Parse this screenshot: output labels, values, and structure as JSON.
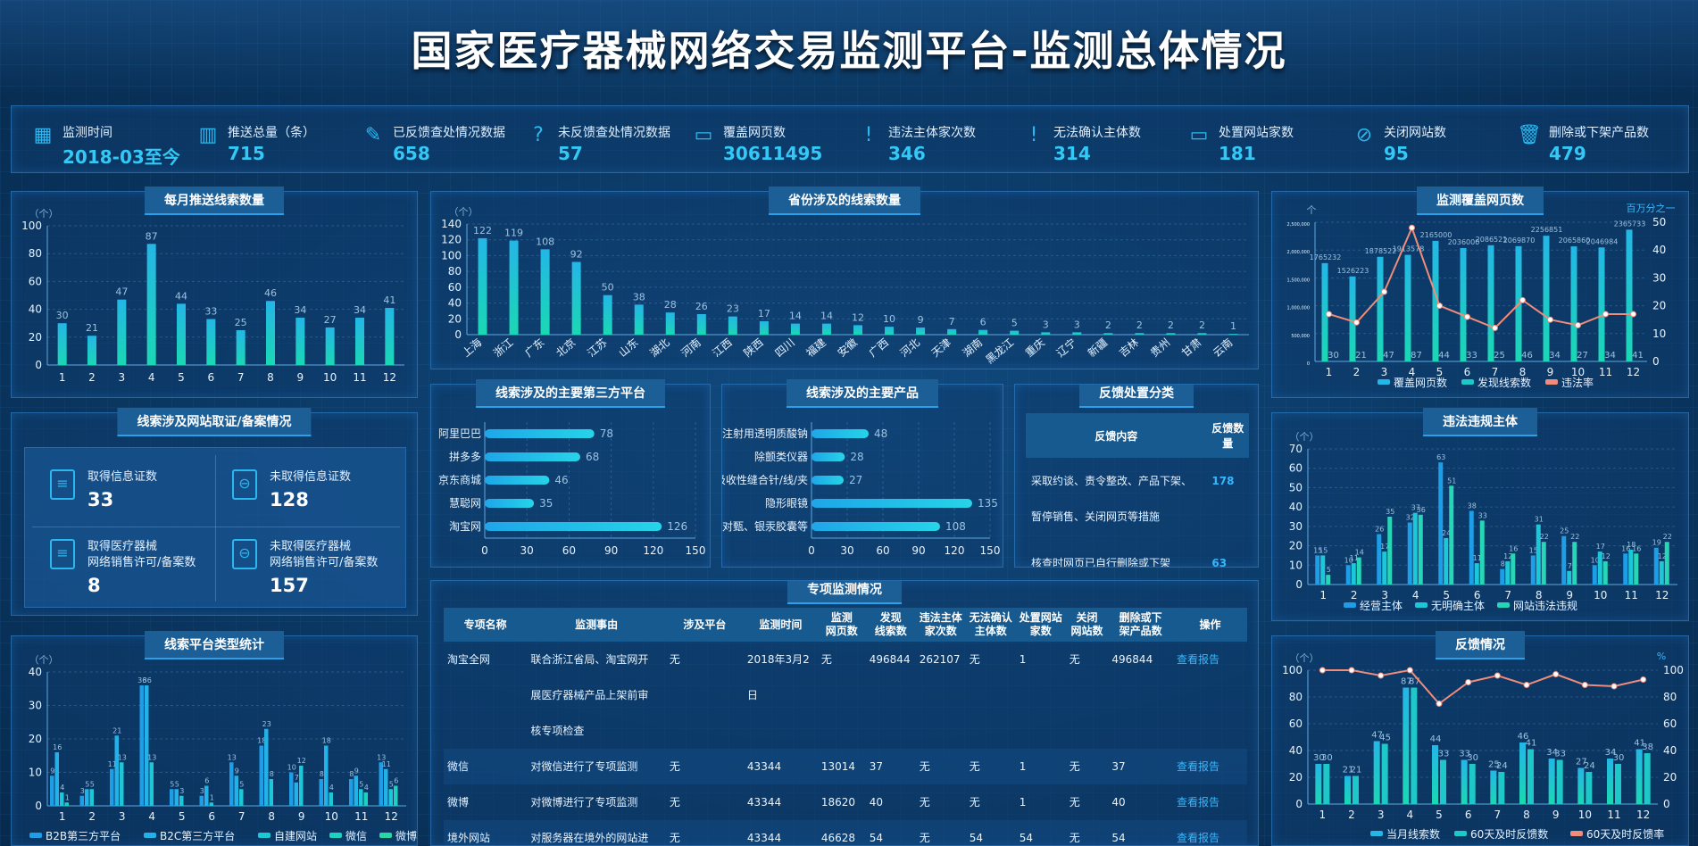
{
  "title": "国家医疗器械网络交易监测平台-监测总体情况",
  "stats": [
    {
      "icon": "calendar-icon",
      "label": "监测时间",
      "value": "2018-03至今"
    },
    {
      "icon": "bar-chart-icon",
      "label": "推送总量（条）",
      "value": "715"
    },
    {
      "icon": "document-edit-icon",
      "label": "已反馈查处情况数据",
      "value": "658"
    },
    {
      "icon": "document-question-icon",
      "label": "未反馈查处情况数据",
      "value": "57"
    },
    {
      "icon": "monitor-icon",
      "label": "覆盖网页数",
      "value": "30611495"
    },
    {
      "icon": "alert-icon",
      "label": "违法主体家次数",
      "value": "346"
    },
    {
      "icon": "alert-icon",
      "label": "无法确认主体数",
      "value": "314"
    },
    {
      "icon": "monitor-icon",
      "label": "处置网站家数",
      "value": "181"
    },
    {
      "icon": "ban-icon",
      "label": "关闭网站数",
      "value": "95"
    },
    {
      "icon": "trash-icon",
      "label": "删除或下架产品数",
      "value": "479"
    }
  ],
  "panels": {
    "monthly": "每月推送线索数量",
    "province": "省份涉及的线索数量",
    "coverage": "监测覆盖网页数",
    "license": "线索涉及网站取证/备案情况",
    "platforms": "线索涉及的主要第三方平台",
    "products": "线索涉及的主要产品",
    "feedback_cat": "反馈处置分类",
    "violation": "违法违规主体",
    "platform_type": "线索平台类型统计",
    "special": "专项监测情况",
    "feedback": "反馈情况"
  },
  "license": [
    {
      "icon": "document-icon",
      "label": "取得信息证数",
      "value": "33"
    },
    {
      "icon": "document-minus-icon",
      "label": "未取得信息证数",
      "value": "128"
    },
    {
      "icon": "document-icon",
      "label": "取得医疗器械\n网络销售许可/备案数",
      "value": "8"
    },
    {
      "icon": "document-minus-icon",
      "label": "未取得医疗器械\n网络销售许可/备案数",
      "value": "157"
    }
  ],
  "feedback_cat": {
    "headers": [
      "反馈内容",
      "反馈数量"
    ],
    "rows": [
      {
        "content": "采取约谈、责令整改、产品下架、暂停销售、关闭网页等措施",
        "count": "178"
      },
      {
        "content": "核查时网页已自行删除或下架",
        "count": "63"
      }
    ]
  },
  "special": {
    "headers": [
      "专项名称",
      "监测事由",
      "涉及平台",
      "监测时间",
      "监测\n网页数",
      "发现\n线索数",
      "违法主体\n家次数",
      "无法确认\n主体数",
      "处置网站\n家数",
      "关闭\n网站数",
      "删除或下\n架产品数",
      "操作"
    ],
    "rows": [
      [
        "淘宝全网",
        "联合浙江省局、淘宝网开\n展医疗器械产品上架前审\n核专项检查",
        "无",
        "2018年3月2日",
        "无",
        "496844",
        "262107",
        "无",
        "1",
        "无",
        "496844",
        "查看报告"
      ],
      [
        "微信",
        "对微信进行了专项监测",
        "无",
        "43344",
        "13014",
        "37",
        "无",
        "无",
        "1",
        "无",
        "37",
        "查看报告"
      ],
      [
        "微博",
        "对微博进行了专项监测",
        "无",
        "43344",
        "18620",
        "40",
        "无",
        "无",
        "1",
        "无",
        "40",
        "查看报告"
      ],
      [
        "境外网站",
        "对服务器在境外的网站进",
        "无",
        "43344",
        "46628",
        "54",
        "无",
        "54",
        "54",
        "无",
        "54",
        "查看报告"
      ]
    ]
  },
  "chart_data": [
    {
      "id": "monthly",
      "type": "bar",
      "ylabel": "（个）",
      "ylim": [
        0,
        100
      ],
      "categories": [
        "1",
        "2",
        "3",
        "4",
        "5",
        "6",
        "7",
        "8",
        "9",
        "10",
        "11",
        "12"
      ],
      "values": [
        30,
        21,
        47,
        87,
        44,
        33,
        25,
        46,
        34,
        27,
        34,
        41
      ]
    },
    {
      "id": "province",
      "type": "bar",
      "ylabel": "（个）",
      "ylim": [
        0,
        140
      ],
      "categories": [
        "上海",
        "浙江",
        "广东",
        "北京",
        "江苏",
        "山东",
        "湖北",
        "河南",
        "江西",
        "陕西",
        "四川",
        "福建",
        "安徽",
        "广西",
        "河北",
        "天津",
        "湖南",
        "黑龙江",
        "重庆",
        "辽宁",
        "新疆",
        "吉林",
        "贵州",
        "甘肃",
        "云南"
      ],
      "values": [
        122,
        119,
        108,
        92,
        50,
        38,
        28,
        26,
        23,
        17,
        14,
        14,
        12,
        10,
        9,
        7,
        6,
        5,
        3,
        3,
        2,
        2,
        2,
        2,
        1
      ]
    },
    {
      "id": "coverage",
      "type": "bar+line",
      "ylabel": "个",
      "ylabel2": "百万分之一",
      "categories": [
        "1",
        "2",
        "3",
        "4",
        "5",
        "6",
        "7",
        "8",
        "9",
        "10",
        "11",
        "12"
      ],
      "series": [
        {
          "name": "覆盖网页数",
          "values": [
            1765232,
            1526223,
            1878522,
            1913578,
            2165000,
            2036000,
            2086521,
            2069870,
            2256851,
            2065860,
            2046984,
            2365733
          ]
        },
        {
          "name": "发现线索数",
          "values": [
            30,
            21,
            47,
            87,
            44,
            33,
            25,
            46,
            34,
            27,
            34,
            41
          ]
        },
        {
          "name": "违法率",
          "values": [
            17,
            14,
            25,
            48,
            20,
            16,
            12,
            22,
            15,
            13,
            17,
            17
          ]
        }
      ],
      "ylim": [
        0,
        2500000
      ],
      "y2lim": [
        0,
        50
      ]
    },
    {
      "id": "platforms",
      "type": "hbar",
      "categories": [
        "阿里巴巴",
        "拼多多",
        "京东商城",
        "慧聪网",
        "淘宝网"
      ],
      "values": [
        78,
        68,
        46,
        35,
        126
      ],
      "xlim": [
        0,
        150
      ]
    },
    {
      "id": "products",
      "type": "hbar",
      "categories": [
        "注射用透明质酸钠",
        "除颤类仪器",
        "可吸收性缝合针/线/夹",
        "隐形眼镜",
        "对甄、银汞胶囊等"
      ],
      "values": [
        48,
        28,
        27,
        135,
        108
      ],
      "xlim": [
        0,
        150
      ]
    },
    {
      "id": "violation",
      "type": "grouped-bar",
      "ylabel": "（个）",
      "ylim": [
        0,
        70
      ],
      "categories": [
        "1",
        "2",
        "3",
        "4",
        "5",
        "6",
        "7",
        "8",
        "9",
        "10",
        "11",
        "12"
      ],
      "series": [
        {
          "name": "经营主体",
          "values": [
            15,
            10,
            26,
            32,
            63,
            38,
            8,
            15,
            25,
            10,
            16,
            19
          ]
        },
        {
          "name": "无明确主体",
          "values": [
            15,
            11,
            17,
            37,
            24,
            11,
            12,
            31,
            7,
            17,
            18,
            12
          ]
        },
        {
          "name": "网站违法违规",
          "values": [
            5,
            14,
            35,
            36,
            51,
            33,
            16,
            22,
            22,
            12,
            16,
            22
          ]
        }
      ]
    },
    {
      "id": "platform_type",
      "type": "grouped-bar",
      "ylabel": "（个）",
      "ylim": [
        0,
        40
      ],
      "categories": [
        "1",
        "2",
        "3",
        "4",
        "5",
        "6",
        "7",
        "8",
        "9",
        "10",
        "11",
        "12"
      ],
      "series": [
        {
          "name": "B2B第三方平台",
          "values": [
            9,
            3,
            11,
            36,
            5,
            3,
            13,
            18,
            10,
            8,
            8,
            13
          ]
        },
        {
          "name": "B2C第三方平台",
          "values": [
            16,
            5,
            21,
            36,
            5,
            6,
            9,
            23,
            7,
            18,
            9,
            11
          ]
        },
        {
          "name": "自建网站",
          "values": [
            4,
            5,
            13,
            13,
            3,
            1,
            5,
            8,
            12,
            4,
            5,
            5
          ]
        },
        {
          "name": "微信",
          "values": [
            1,
            0,
            0,
            0,
            0,
            0,
            0,
            0,
            0,
            0,
            4,
            6
          ]
        },
        {
          "name": "微博",
          "values": [
            0,
            0,
            0,
            0,
            0,
            0,
            0,
            0,
            0,
            0,
            0,
            0
          ]
        }
      ]
    },
    {
      "id": "feedback",
      "type": "bar+line",
      "ylabel": "（个）",
      "ylabel2": "%",
      "ylim": [
        0,
        100
      ],
      "y2lim": [
        0,
        100
      ],
      "categories": [
        "1",
        "2",
        "3",
        "4",
        "5",
        "6",
        "7",
        "8",
        "9",
        "10",
        "11",
        "12"
      ],
      "series": [
        {
          "name": "当月线索数",
          "values": [
            30,
            21,
            47,
            87,
            44,
            33,
            25,
            46,
            34,
            27,
            34,
            41
          ]
        },
        {
          "name": "60天及时反馈数",
          "values": [
            30,
            21,
            45,
            87,
            33,
            30,
            24,
            41,
            33,
            24,
            30,
            38
          ]
        },
        {
          "name": "60天及时反馈率",
          "values": [
            100,
            100,
            96,
            100,
            75,
            91,
            96,
            89,
            97,
            89,
            88,
            93
          ]
        }
      ]
    }
  ],
  "colors": {
    "accent": "#2bb8f0",
    "bar_top": "#24b6e6",
    "bar_bottom": "#1ad8b4",
    "line": "#f08c7a"
  }
}
